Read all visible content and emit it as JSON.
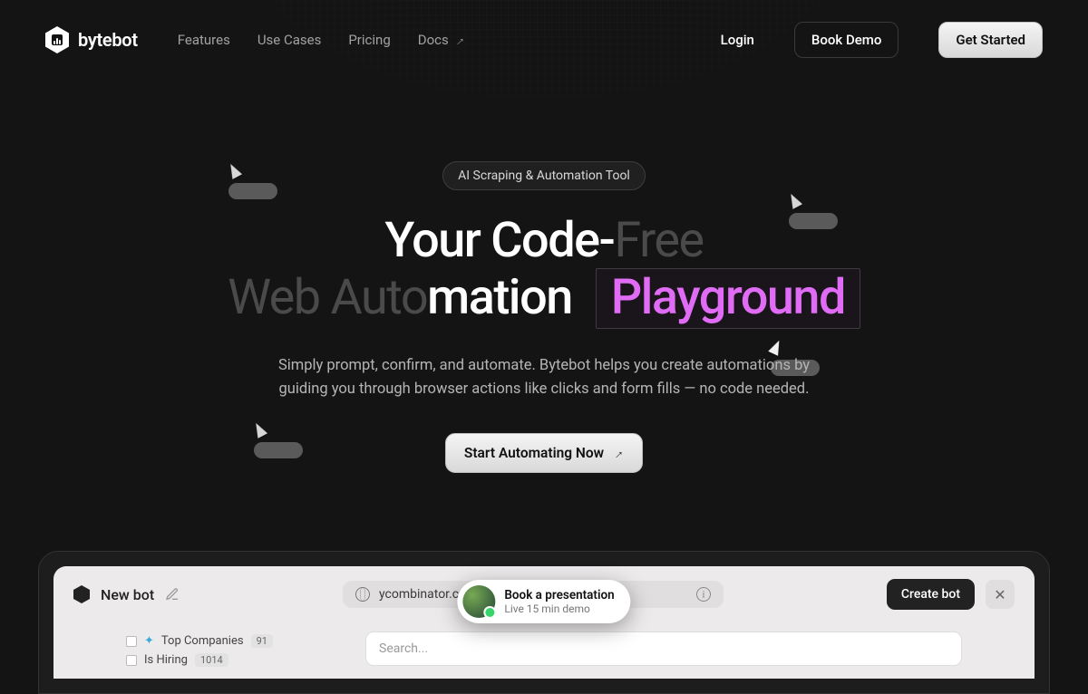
{
  "brand": {
    "name": "bytebot"
  },
  "nav": {
    "links": [
      {
        "label": "Features"
      },
      {
        "label": "Use Cases"
      },
      {
        "label": "Pricing"
      },
      {
        "label": "Docs"
      }
    ],
    "login": "Login",
    "book_demo": "Book Demo",
    "get_started": "Get Started"
  },
  "hero": {
    "pill": "AI Scraping & Automation Tool",
    "title_line1_a": "Your Code-",
    "title_line1_b": "Free",
    "title_line2_a": "Web Auto",
    "title_line2_b": "mation",
    "title_boxed": "Playground",
    "subtitle": "Simply prompt, confirm, and automate. Bytebot helps you create automations by guiding you through browser actions like clicks and form fills — no code needed.",
    "cta": "Start Automating Now"
  },
  "mock": {
    "title": "New bot",
    "url": "ycombinator.co",
    "create_label": "Create bot",
    "search_placeholder": "Search...",
    "side_items": [
      {
        "label": "Top Companies",
        "count": "91",
        "star": true
      },
      {
        "label": "Is Hiring",
        "count": "1014"
      }
    ]
  },
  "presence": {
    "line1": "Book a presentation",
    "line2": "Live 15 min demo"
  }
}
